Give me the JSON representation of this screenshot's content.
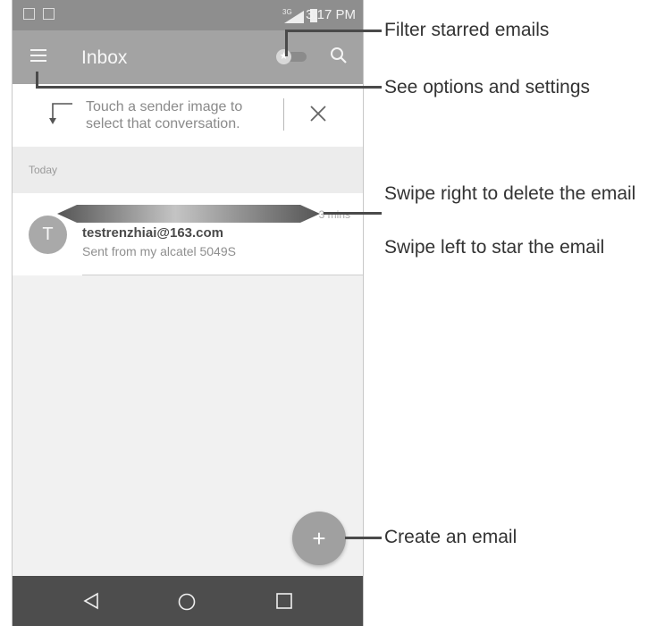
{
  "status_bar": {
    "time": "3:17 PM",
    "network": "3G"
  },
  "app_bar": {
    "title": "Inbox"
  },
  "hint": {
    "text": "Touch a sender image to select that conversation."
  },
  "section": {
    "label": "Today"
  },
  "email": {
    "avatar_letter": "T",
    "sender": "testrenzhiai@163.com",
    "preview": "Sent from my alcatel 5049S",
    "time": "3 mins"
  },
  "fab": {
    "symbol": "+"
  },
  "callouts": [
    "Filter starred emails",
    "See options and settings",
    "Swipe right to delete the email",
    "Swipe left to star the email",
    "Create an email"
  ],
  "colors": {
    "app_bar": "#a3a3a3",
    "status_bar": "#8e8e8e",
    "nav_bar": "#4d4d4d",
    "fab": "#a0a0a0"
  }
}
